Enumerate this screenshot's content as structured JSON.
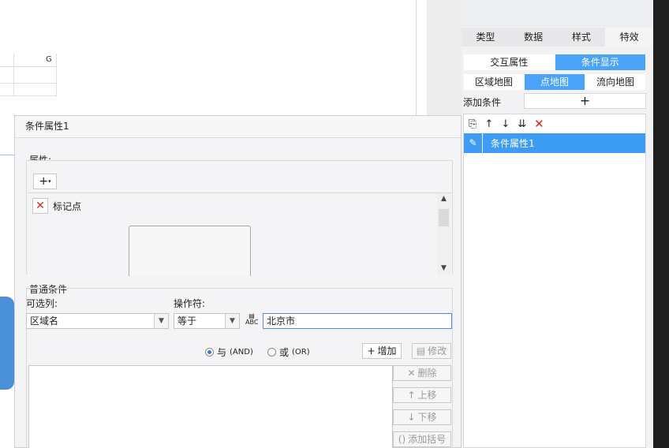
{
  "sheet": {
    "column_g": "G"
  },
  "right_panel": {
    "tabs": [
      {
        "label": "类型",
        "active": false
      },
      {
        "label": "数据",
        "active": false
      },
      {
        "label": "样式",
        "active": false
      },
      {
        "label": "特效",
        "active": true
      }
    ],
    "mode_toggle": [
      {
        "label": "交互属性",
        "active": false
      },
      {
        "label": "条件显示",
        "active": true
      }
    ],
    "map_type": [
      {
        "label": "区域地图",
        "active": false
      },
      {
        "label": "点地图",
        "active": true
      },
      {
        "label": "流向地图",
        "active": false
      }
    ],
    "add_condition_label": "添加条件",
    "add_condition_glyph": "+",
    "toolbar_glyphs": {
      "copy": "⎘",
      "up": "↑",
      "down": "↓",
      "move_bottom": "⇊",
      "delete": "✕"
    },
    "conditions": [
      {
        "label": "条件属性1",
        "selected": true
      }
    ]
  },
  "dialog": {
    "title": "条件属性1",
    "attributes_label": "属性:",
    "add_dropdown_glyph": "+",
    "attribute_items": [
      {
        "label": "标记点"
      }
    ],
    "normal_condition_label": "普通条件",
    "optional_column_label": "可选列:",
    "optional_column_value": "区域名",
    "operator_label": "操作符:",
    "operator_value": "等于",
    "value_input": "北京市",
    "radio_and": "与",
    "radio_and_tag": "(AND)",
    "radio_or": "或",
    "radio_or_tag": "(OR)",
    "radio_selected": "and",
    "buttons": {
      "add": "增加",
      "modify": "修改",
      "delete": "删除",
      "move_up": "上移",
      "move_down": "下移",
      "add_bracket": "添加括号"
    }
  },
  "colors": {
    "accent": "#3d9df5",
    "delete_red": "#e0241b"
  }
}
